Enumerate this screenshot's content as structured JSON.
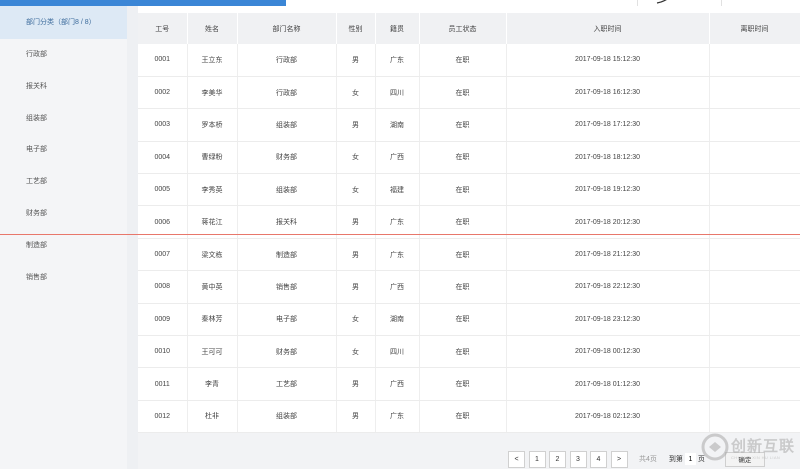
{
  "sidebar": {
    "header": "部门分类（部门8 / 8）",
    "items": [
      {
        "label": "行政部"
      },
      {
        "label": "报关科"
      },
      {
        "label": "组装部"
      },
      {
        "label": "电子部"
      },
      {
        "label": "工艺部"
      },
      {
        "label": "财务部"
      },
      {
        "label": "制造部"
      },
      {
        "label": "销售部"
      }
    ]
  },
  "table": {
    "columns": [
      "工号",
      "姓名",
      "部门名称",
      "性别",
      "籍贯",
      "员工状态",
      "入职时间",
      "离职时间"
    ],
    "rows": [
      [
        "0001",
        "王立东",
        "行政部",
        "男",
        "广东",
        "在职",
        "2017-09-18 15:12:30",
        ""
      ],
      [
        "0002",
        "李美华",
        "行政部",
        "女",
        "四川",
        "在职",
        "2017-09-18 16:12:30",
        ""
      ],
      [
        "0003",
        "罗本桥",
        "组装部",
        "男",
        "湖南",
        "在职",
        "2017-09-18 17:12:30",
        ""
      ],
      [
        "0004",
        "曹绿粉",
        "财务部",
        "女",
        "广西",
        "在职",
        "2017-09-18 18:12:30",
        ""
      ],
      [
        "0005",
        "李秀英",
        "组装部",
        "女",
        "福建",
        "在职",
        "2017-09-18 19:12:30",
        ""
      ],
      [
        "0006",
        "蒋花江",
        "报关科",
        "男",
        "广东",
        "在职",
        "2017-09-18 20:12:30",
        ""
      ],
      [
        "0007",
        "梁文栋",
        "制造部",
        "男",
        "广东",
        "在职",
        "2017-09-18 21:12:30",
        ""
      ],
      [
        "0008",
        "黄中英",
        "销售部",
        "男",
        "广西",
        "在职",
        "2017-09-18 22:12:30",
        ""
      ],
      [
        "0009",
        "秦林芳",
        "电子部",
        "女",
        "湖南",
        "在职",
        "2017-09-18 23:12:30",
        ""
      ],
      [
        "0010",
        "王可可",
        "财务部",
        "女",
        "四川",
        "在职",
        "2017-09-18 00:12:30",
        ""
      ],
      [
        "0011",
        "李青",
        "工艺部",
        "男",
        "广西",
        "在职",
        "2017-09-18 01:12:30",
        ""
      ],
      [
        "0012",
        "杜非",
        "组装部",
        "男",
        "广东",
        "在职",
        "2017-09-18 02:12:30",
        ""
      ]
    ]
  },
  "pagination": {
    "prev": "<",
    "pages": [
      "1",
      "2",
      "3",
      "4"
    ],
    "next": ">",
    "total": "共4页",
    "goto_prefix": "到第",
    "goto_value": "1",
    "goto_suffix": "页",
    "confirm": "确定"
  },
  "watermark": {
    "text": "创新互联",
    "sub": "CHUANG XIN HU LIAN"
  },
  "colors": {
    "accent": "#3b86d6",
    "sidebar_active": "#dde9f5",
    "divider_red": "#e8776b"
  }
}
